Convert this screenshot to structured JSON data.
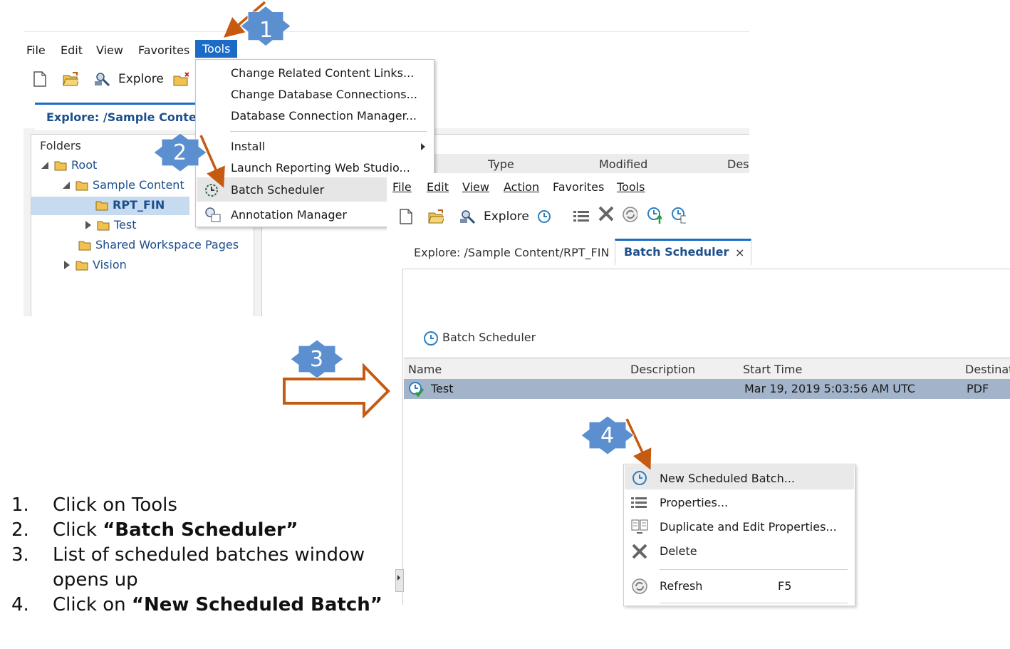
{
  "window1": {
    "menu": [
      "File",
      "Edit",
      "View",
      "Favorites",
      "Tools"
    ],
    "toolbar_explore": "Explore",
    "tab_label": "Explore: /Sample Conten",
    "folders_header": "Folders",
    "tree": [
      "Root",
      "Sample Content",
      "RPT_FIN",
      "Test",
      "Shared Workspace Pages",
      "Vision"
    ],
    "columns": [
      "Type",
      "Modified",
      "Des"
    ]
  },
  "tools_menu": {
    "items": [
      "Change Related Content Links...",
      "Change Database Connections...",
      "Database Connection Manager...",
      "Install",
      "Launch Reporting Web Studio...",
      "Batch Scheduler",
      "Annotation Manager"
    ]
  },
  "window2": {
    "menu": [
      "File",
      "Edit",
      "View",
      "Action",
      "Favorites",
      "Tools"
    ],
    "toolbar_explore": "Explore",
    "tab_explore": "Explore: /Sample Content/RPT_FIN",
    "tab_batch": "Batch Scheduler",
    "tab_close": "×",
    "panel_title": "Batch Scheduler",
    "columns": [
      "Name",
      "Description",
      "Start Time",
      "Destinat"
    ],
    "row": {
      "name": "Test",
      "description": "",
      "start_time": "Mar 19, 2019 5:03:56 AM UTC",
      "destination": "PDF"
    }
  },
  "context_menu": {
    "items": [
      "New Scheduled Batch...",
      "Properties...",
      "Duplicate and Edit Properties...",
      "Delete",
      "Refresh"
    ],
    "refresh_shortcut": "F5"
  },
  "callouts": [
    "1",
    "2",
    "3",
    "4"
  ],
  "instructions": [
    {
      "num": "1.",
      "text": "Click on Tools"
    },
    {
      "num": "2.",
      "pre": "Click ",
      "bold": "“Batch Scheduler”"
    },
    {
      "num": "3.",
      "text": "List of scheduled batches window",
      "text2": "opens up"
    },
    {
      "num": "4.",
      "pre": "Click on ",
      "bold": "“New Scheduled Batch”"
    }
  ],
  "colors": {
    "accent": "#1c6cc7",
    "callout": "#5b8fd0",
    "arrow": "#c55a11",
    "selected_row": "#a3b3c9"
  }
}
